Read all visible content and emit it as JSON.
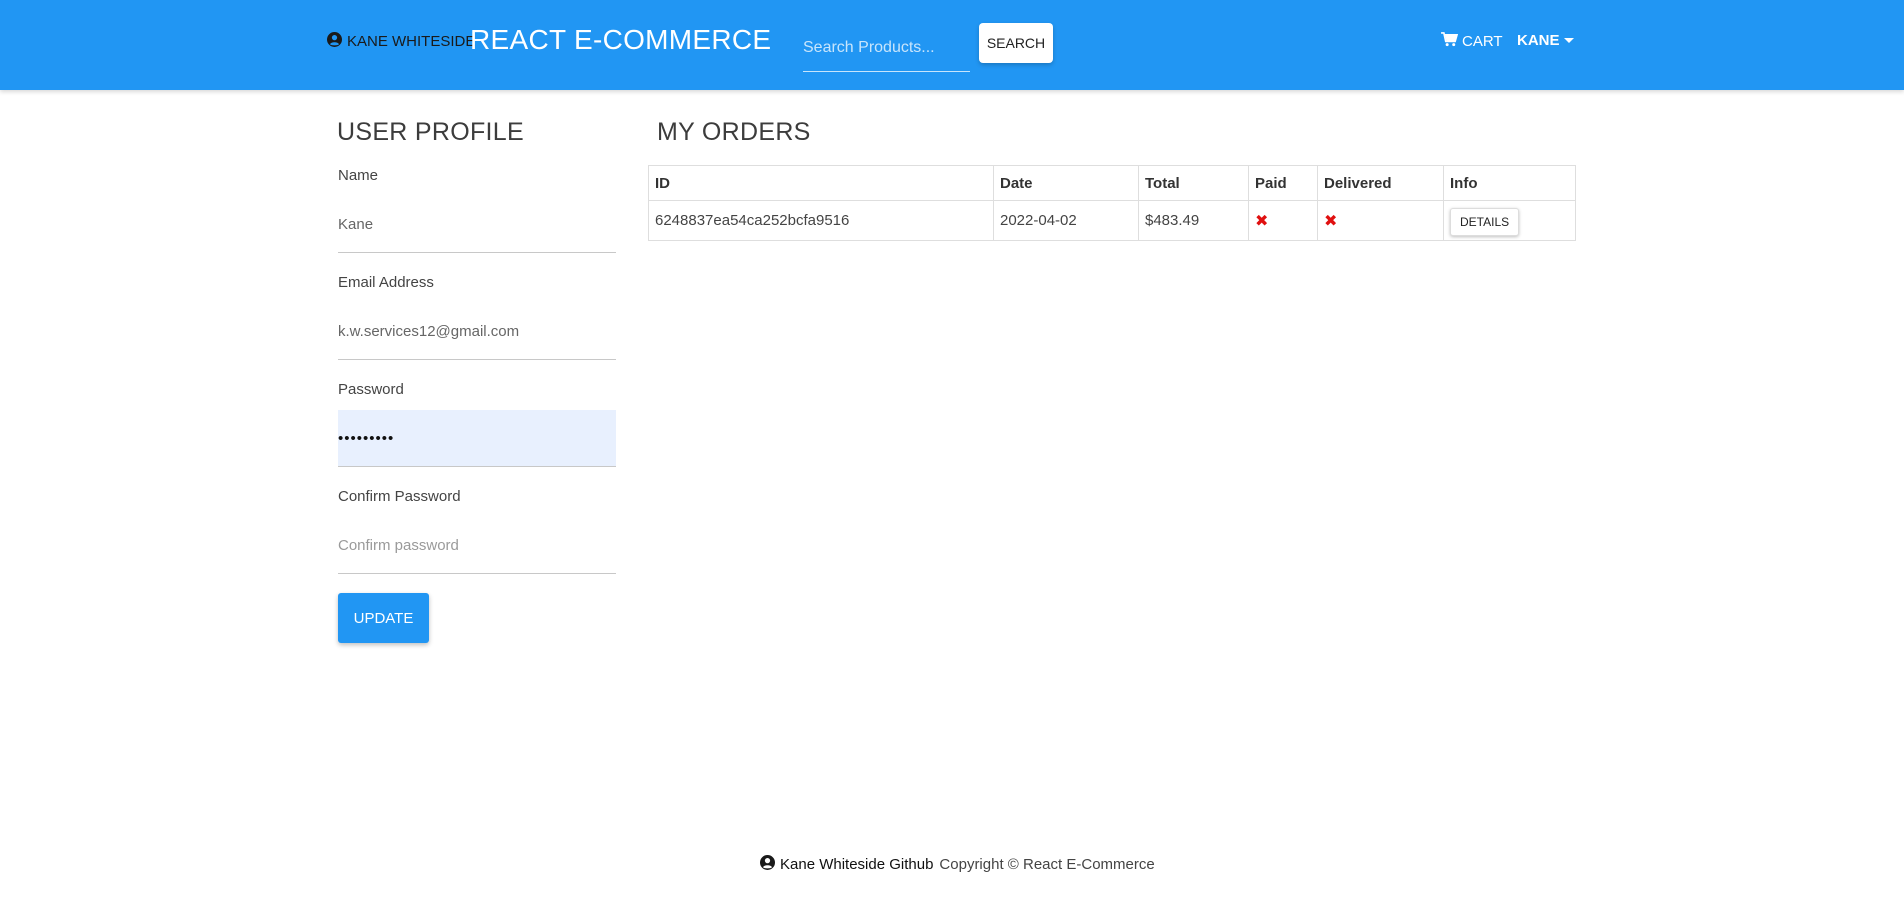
{
  "navbar": {
    "author_link": "KANE WHITESIDE",
    "author_icon": "user-circle-icon",
    "title": "REACT E-COMMERCE",
    "search_placeholder": "Search Products...",
    "search_button": "SEARCH",
    "cart_label": "CART",
    "cart_icon": "shopping-cart-icon",
    "user_menu_label": "KANE",
    "bg_color": "#2196f3"
  },
  "profile": {
    "heading": "USER PROFILE",
    "fields": [
      {
        "label": "Name",
        "value": "Kane",
        "placeholder": ""
      },
      {
        "label": "Email Address",
        "value": "k.w.services12@gmail.com",
        "placeholder": ""
      },
      {
        "label": "Password",
        "value": "•••••••••",
        "placeholder": ""
      },
      {
        "label": "Confirm Password",
        "value": "",
        "placeholder": "Confirm password"
      }
    ],
    "update_button": "UPDATE"
  },
  "orders": {
    "heading": "MY ORDERS",
    "columns": [
      "ID",
      "Date",
      "Total",
      "Paid",
      "Delivered",
      "Info"
    ],
    "rows": [
      {
        "id": "6248837ea54ca252bcfa9516",
        "date": "2022-04-02",
        "total": "$483.49",
        "paid": "✖",
        "delivered": "✖",
        "info_button": "DETAILS"
      }
    ],
    "status_color": "#e01010"
  },
  "footer": {
    "github_link": "Kane Whiteside Github",
    "github_icon": "user-circle-icon",
    "copyright": "Copyright © React E-Commerce"
  }
}
